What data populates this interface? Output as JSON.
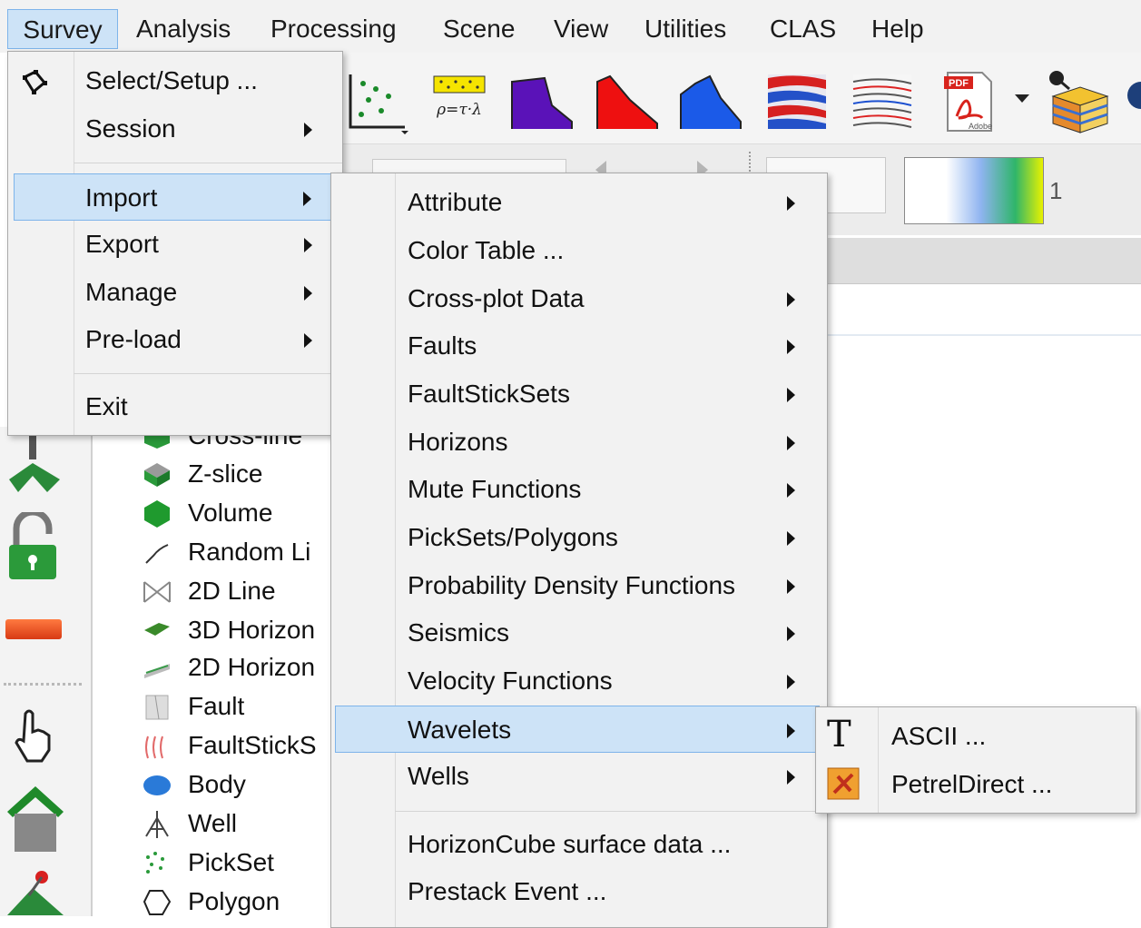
{
  "menubar": {
    "items": [
      "Survey",
      "Analysis",
      "Processing",
      "Scene",
      "View",
      "Utilities",
      "CLAS",
      "Help"
    ],
    "active_index": 0
  },
  "toolbar": {
    "icons": [
      "crossplot-icon",
      "rho-tau-lambda-icon",
      "purple-spectrum-icon",
      "red-spectrum-icon",
      "blue-spectrum-icon",
      "seismic-redblue-icon",
      "seismic-section-icon",
      "pdf-icon",
      "horizon-cube-icon"
    ],
    "rho_text": "ρ=τ·λ",
    "pdf_label": "PDF",
    "adobe_label": "Adobe"
  },
  "colorbar": {
    "value": "1"
  },
  "survey_menu": {
    "items": [
      {
        "label": "Select/Setup ...",
        "submenu": false
      },
      {
        "label": "Session",
        "submenu": true
      },
      {
        "label": "Import",
        "submenu": true,
        "highlighted": true
      },
      {
        "label": "Export",
        "submenu": true
      },
      {
        "label": "Manage",
        "submenu": true
      },
      {
        "label": "Pre-load",
        "submenu": true
      },
      {
        "label": "Exit",
        "submenu": false
      }
    ]
  },
  "import_menu": {
    "items": [
      {
        "label": "Attribute",
        "submenu": true
      },
      {
        "label": "Color Table ...",
        "submenu": false
      },
      {
        "label": "Cross-plot Data",
        "submenu": true
      },
      {
        "label": "Faults",
        "submenu": true
      },
      {
        "label": "FaultStickSets",
        "submenu": true
      },
      {
        "label": "Horizons",
        "submenu": true
      },
      {
        "label": "Mute Functions",
        "submenu": true
      },
      {
        "label": "PickSets/Polygons",
        "submenu": true
      },
      {
        "label": "Probability Density Functions",
        "submenu": true
      },
      {
        "label": "Seismics",
        "submenu": true
      },
      {
        "label": "Velocity Functions",
        "submenu": true
      },
      {
        "label": "Wavelets",
        "submenu": true,
        "highlighted": true
      },
      {
        "label": "Wells",
        "submenu": true
      },
      {
        "label": "HorizonCube surface data ...",
        "submenu": false
      },
      {
        "label": "Prestack Event ...",
        "submenu": false
      }
    ]
  },
  "wavelets_menu": {
    "items": [
      {
        "label": "ASCII ...",
        "icon": "text-t-icon"
      },
      {
        "label": "PetrelDirect ...",
        "icon": "petrel-icon"
      }
    ]
  },
  "tree": {
    "items": [
      {
        "label": "Cross-line",
        "icon": "crossline-icon"
      },
      {
        "label": "Z-slice",
        "icon": "zslice-icon"
      },
      {
        "label": "Volume",
        "icon": "volume-icon"
      },
      {
        "label": "Random Li",
        "icon": "random-line-icon"
      },
      {
        "label": "2D Line",
        "icon": "2d-line-icon"
      },
      {
        "label": "3D Horizon",
        "icon": "3d-horizon-icon"
      },
      {
        "label": "2D Horizon",
        "icon": "2d-horizon-icon"
      },
      {
        "label": "Fault",
        "icon": "fault-icon"
      },
      {
        "label": "FaultStickS",
        "icon": "faultsticks-icon"
      },
      {
        "label": "Body",
        "icon": "body-icon"
      },
      {
        "label": "Well",
        "icon": "well-icon"
      },
      {
        "label": "PickSet",
        "icon": "pickset-icon"
      },
      {
        "label": "Polygon",
        "icon": "polygon-icon"
      }
    ]
  },
  "left_toolbar": {
    "icons": [
      "tree-view-icon",
      "unlock-icon",
      "red-bar-icon",
      "pointer-hand-icon",
      "home-icon",
      "seek-icon"
    ]
  },
  "colors": {
    "highlight": "#cde3f7",
    "highlight_border": "#7eb4ea",
    "menu_bg": "#f2f2f2"
  }
}
